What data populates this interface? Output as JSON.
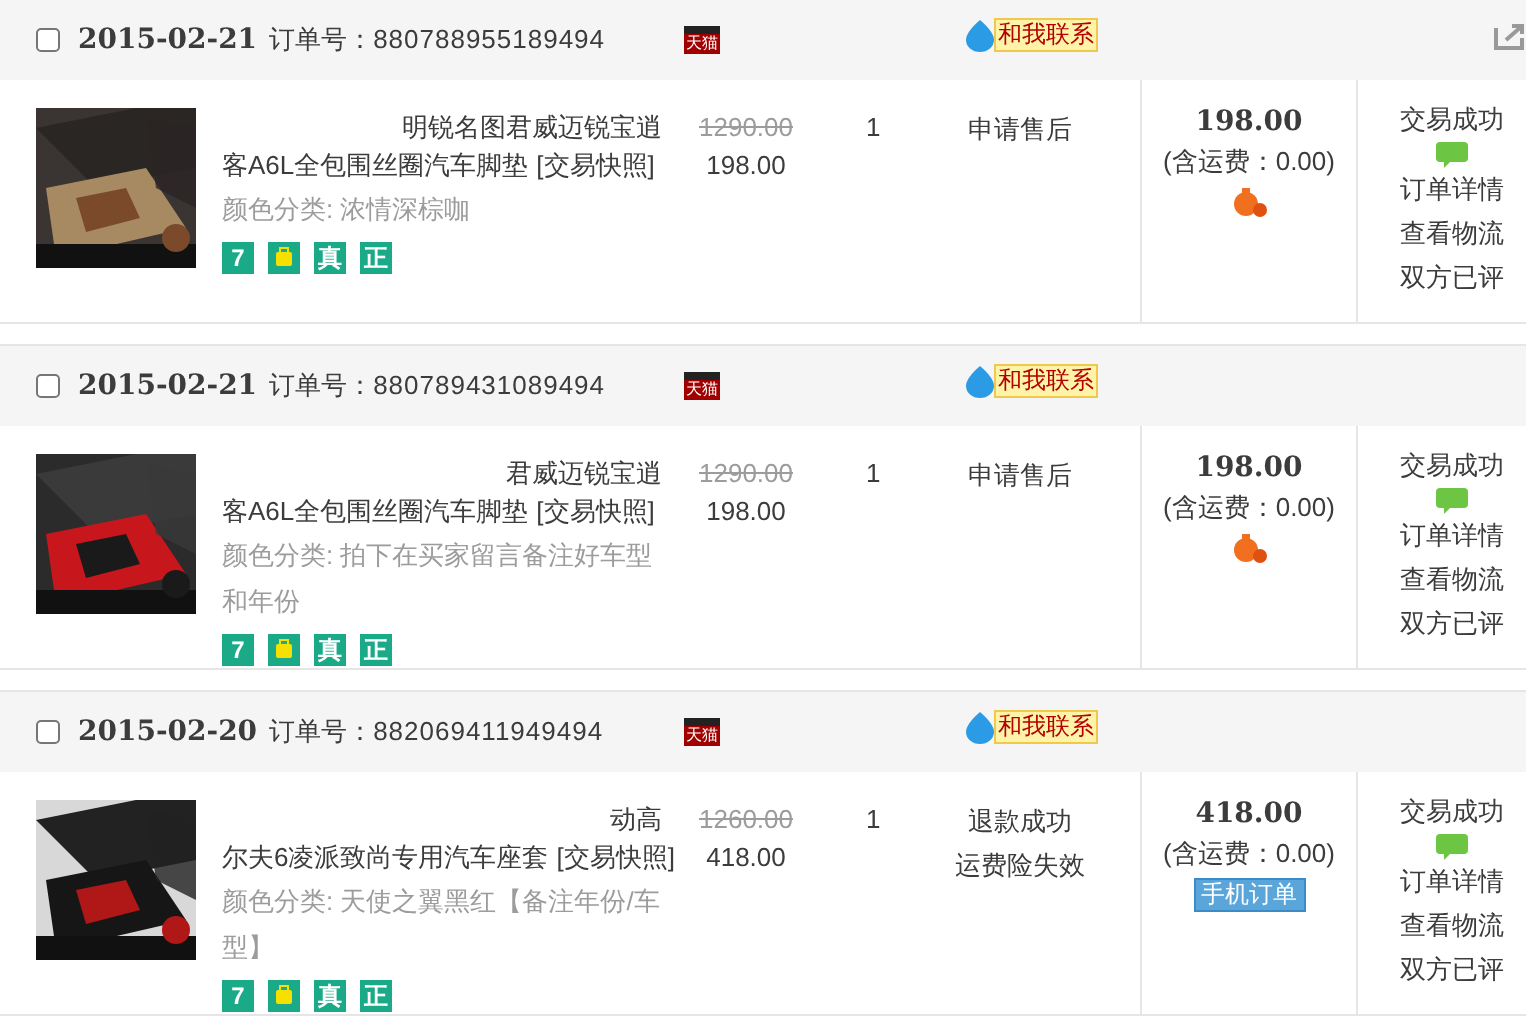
{
  "orders": [
    {
      "checked": false,
      "date": "2015-02-21",
      "order_no_label": "订单号：",
      "order_no": "880788955189494",
      "store_badge": "天猫",
      "contact": "和我联系",
      "item": {
        "title_line_1": "明锐名图君威迈锐宝逍",
        "title_line_2": "客A6L全包围丝圈汽车脚垫",
        "snapshot": "[交易快照]",
        "variant": "颜色分类: 浓情深棕咖",
        "tags": [
          {
            "kind": "text",
            "text": "7"
          },
          {
            "kind": "icon"
          },
          {
            "kind": "text",
            "text": "真"
          },
          {
            "kind": "text",
            "text": "正"
          }
        ],
        "original_price": "1290.00",
        "price": "198.00",
        "qty": "1",
        "status_lines": [
          "申请售后"
        ]
      },
      "total": "198.00",
      "shipping": "(含运费：0.00)",
      "extra": {
        "kind": "coin"
      },
      "actions": [
        {
          "kind": "text",
          "text": "交易成功"
        },
        {
          "kind": "chat"
        },
        {
          "kind": "text",
          "text": "订单详情"
        },
        {
          "kind": "text",
          "text": "查看物流"
        },
        {
          "kind": "text",
          "text": "双方已评"
        }
      ]
    },
    {
      "checked": false,
      "date": "2015-02-21",
      "order_no_label": "订单号：",
      "order_no": "880789431089494",
      "store_badge": "天猫",
      "contact": "和我联系",
      "item": {
        "title_line_1": "君威迈锐宝逍",
        "title_line_2": "客A6L全包围丝圈汽车脚垫",
        "snapshot": "[交易快照]",
        "variant": "颜色分类: 拍下在买家留言备注好车型和年份",
        "tags": [
          {
            "kind": "text",
            "text": "7"
          },
          {
            "kind": "icon"
          },
          {
            "kind": "text",
            "text": "真"
          },
          {
            "kind": "text",
            "text": "正"
          }
        ],
        "original_price": "1290.00",
        "price": "198.00",
        "qty": "1",
        "status_lines": [
          "申请售后"
        ]
      },
      "total": "198.00",
      "shipping": "(含运费：0.00)",
      "extra": {
        "kind": "coin"
      },
      "actions": [
        {
          "kind": "text",
          "text": "交易成功"
        },
        {
          "kind": "chat"
        },
        {
          "kind": "text",
          "text": "订单详情"
        },
        {
          "kind": "text",
          "text": "查看物流"
        },
        {
          "kind": "text",
          "text": "双方已评"
        }
      ]
    },
    {
      "checked": false,
      "date": "2015-02-20",
      "order_no_label": "订单号：",
      "order_no": "882069411949494",
      "store_badge": "天猫",
      "contact": "和我联系",
      "item": {
        "title_line_1": "动高",
        "title_line_2": "尔夫6凌派致尚专用汽车座套",
        "snapshot": "[交易快照]",
        "variant": "颜色分类: 天使之翼黑红【备注年份/车型】",
        "tags": [
          {
            "kind": "text",
            "text": "7"
          },
          {
            "kind": "icon"
          },
          {
            "kind": "text",
            "text": "真"
          },
          {
            "kind": "text",
            "text": "正"
          }
        ],
        "original_price": "1260.00",
        "price": "418.00",
        "qty": "1",
        "status_lines": [
          "退款成功",
          "运费险失效"
        ]
      },
      "total": "418.00",
      "shipping": "(含运费：0.00)",
      "extra": {
        "kind": "badge",
        "text": "手机订单"
      },
      "actions": [
        {
          "kind": "text",
          "text": "交易成功"
        },
        {
          "kind": "chat"
        },
        {
          "kind": "text",
          "text": "订单详情"
        },
        {
          "kind": "text",
          "text": "查看物流"
        },
        {
          "kind": "text",
          "text": "双方已评"
        }
      ]
    }
  ]
}
